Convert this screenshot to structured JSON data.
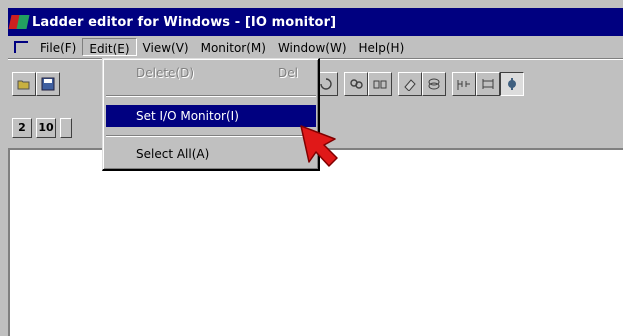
{
  "window": {
    "title": "Ladder editor for Windows - [IO monitor]"
  },
  "menubar": {
    "items": [
      {
        "label": "File(F)"
      },
      {
        "label": "Edit(E)"
      },
      {
        "label": "View(V)"
      },
      {
        "label": "Monitor(M)"
      },
      {
        "label": "Window(W)"
      },
      {
        "label": "Help(H)"
      }
    ]
  },
  "edit_menu": {
    "items": [
      {
        "label": "Delete(D)",
        "shortcut": "Del",
        "state": "disabled"
      },
      {
        "label": "Set I/O Monitor(I)",
        "state": "highlighted"
      },
      {
        "label": "Select All(A)",
        "state": "enabled"
      }
    ]
  },
  "zoom_buttons": [
    "2",
    "10"
  ],
  "colors": {
    "titlebar": "#000080",
    "menu_highlight": "#000080",
    "cursor": "#e01818"
  }
}
